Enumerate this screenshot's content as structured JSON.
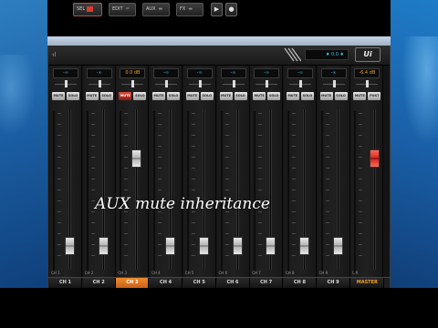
{
  "toolbar": {
    "logo_text": "·ıl",
    "tab1_label": "SEL",
    "tab1_sub": "M",
    "tab2_label": "EDIT",
    "tab2_sub": "",
    "tab3_label": "AUX",
    "tab3_sub": "",
    "tab4_label": "FX",
    "tab4_sub": "",
    "play_icon": "▶",
    "record_icon": "●",
    "display_text": "♦ 0.0 ♦",
    "brand": "Ui"
  },
  "channels": [
    {
      "gain": "-∞",
      "mute": "MUTE",
      "solo": "SOLO",
      "scale_label": "CH 1",
      "tab": "CH 1",
      "fader": 0.1,
      "mute_on": false,
      "gain_color": "cyan"
    },
    {
      "gain": "-∞",
      "mute": "MUTE",
      "solo": "SOLO",
      "scale_label": "CH 2",
      "tab": "CH 2",
      "fader": 0.1,
      "mute_on": false,
      "gain_color": "cyan"
    },
    {
      "gain": "0.0 dB",
      "mute": "MUTE",
      "solo": "SOLO",
      "scale_label": "CH 3",
      "tab": "CH 3",
      "fader": 0.72,
      "mute_on": true,
      "gain_color": "amber"
    },
    {
      "gain": "-∞",
      "mute": "MUTE",
      "solo": "SOLO",
      "scale_label": "CH 4",
      "tab": "CH 4",
      "fader": 0.1,
      "mute_on": false,
      "gain_color": "cyan"
    },
    {
      "gain": "-∞",
      "mute": "MUTE",
      "solo": "SOLO",
      "scale_label": "CH 5",
      "tab": "CH 5",
      "fader": 0.1,
      "mute_on": false,
      "gain_color": "cyan"
    },
    {
      "gain": "-∞",
      "mute": "MUTE",
      "solo": "SOLO",
      "scale_label": "CH 6",
      "tab": "CH 6",
      "fader": 0.1,
      "mute_on": false,
      "gain_color": "cyan"
    },
    {
      "gain": "-∞",
      "mute": "MUTE",
      "solo": "SOLO",
      "scale_label": "CH 7",
      "tab": "CH 7",
      "fader": 0.1,
      "mute_on": false,
      "gain_color": "cyan"
    },
    {
      "gain": "-∞",
      "mute": "MUTE",
      "solo": "SOLO",
      "scale_label": "CH 8",
      "tab": "CH 8",
      "fader": 0.1,
      "mute_on": false,
      "gain_color": "cyan"
    },
    {
      "gain": "-∞",
      "mute": "MUTE",
      "solo": "SOLO",
      "scale_label": "CH 9",
      "tab": "CH 9",
      "fader": 0.1,
      "mute_on": false,
      "gain_color": "cyan"
    }
  ],
  "master": {
    "gain": "-6.4 dB",
    "mute": "MUTE",
    "solo": "POST",
    "scale_label": "L R",
    "tab": "MASTER",
    "fader": 0.72,
    "gain_color": "amber"
  },
  "selected_channel": 3,
  "caption": "AUX mute inheritance",
  "colors": {
    "accent_orange": "#f08a2a",
    "mute_red": "#e24a3a",
    "display_cyan": "#3ac6e8",
    "master_fader": "#d82a20"
  }
}
